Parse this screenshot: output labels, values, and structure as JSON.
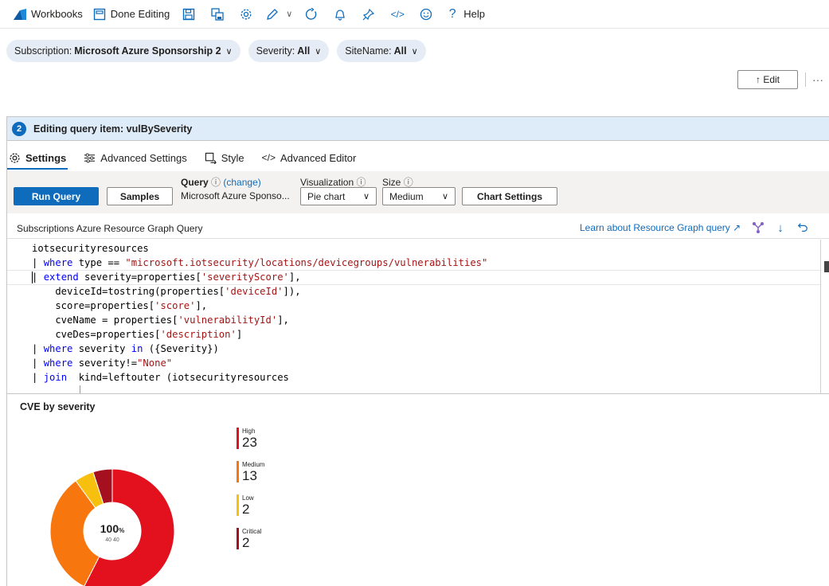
{
  "toolbar": {
    "workbooks_label": "Workbooks",
    "done_editing_label": "Done Editing",
    "help_label": "Help",
    "accent_color": "#0f6cbd"
  },
  "parameters": [
    {
      "name": "Subscription:",
      "value": "Microsoft Azure Sponsorship 2"
    },
    {
      "name": "Severity:",
      "value": "All"
    },
    {
      "name": "SiteName:",
      "value": "All"
    }
  ],
  "edit_button": "↑ Edit",
  "more_label": "···",
  "panel": {
    "step": "2",
    "title": "Editing query item: vulBySeverity",
    "tabs": [
      {
        "label": "Settings",
        "icon": "gear-icon",
        "active": true
      },
      {
        "label": "Advanced Settings",
        "icon": "sliders-icon",
        "active": false
      },
      {
        "label": "Style",
        "icon": "style-icon",
        "active": false
      },
      {
        "label": "Advanced Editor",
        "icon": "code-icon",
        "active": false
      }
    ],
    "run_query": "Run Query",
    "samples": "Samples",
    "query_label": "Query",
    "query_change": "(change)",
    "query_value": "Microsoft Azure Sponso...",
    "visualization_label": "Visualization",
    "visualization_value": "Pie chart",
    "size_label": "Size",
    "size_value": "Medium",
    "chart_settings": "Chart Settings",
    "query_section_title": "Subscriptions Azure Resource Graph Query",
    "learn_link": "Learn about Resource Graph query"
  },
  "chart_data": {
    "type": "pie",
    "title": "CVE by severity",
    "center_value": "100",
    "center_unit": "%",
    "center_sub": "40 40",
    "series": [
      {
        "name": "High",
        "value": 23,
        "color": "#e3101d"
      },
      {
        "name": "Medium",
        "value": 13,
        "color": "#f7760d"
      },
      {
        "name": "Low",
        "value": 2,
        "color": "#f8c00e"
      },
      {
        "name": "Critical",
        "value": 2,
        "color": "#a4101d"
      }
    ]
  }
}
